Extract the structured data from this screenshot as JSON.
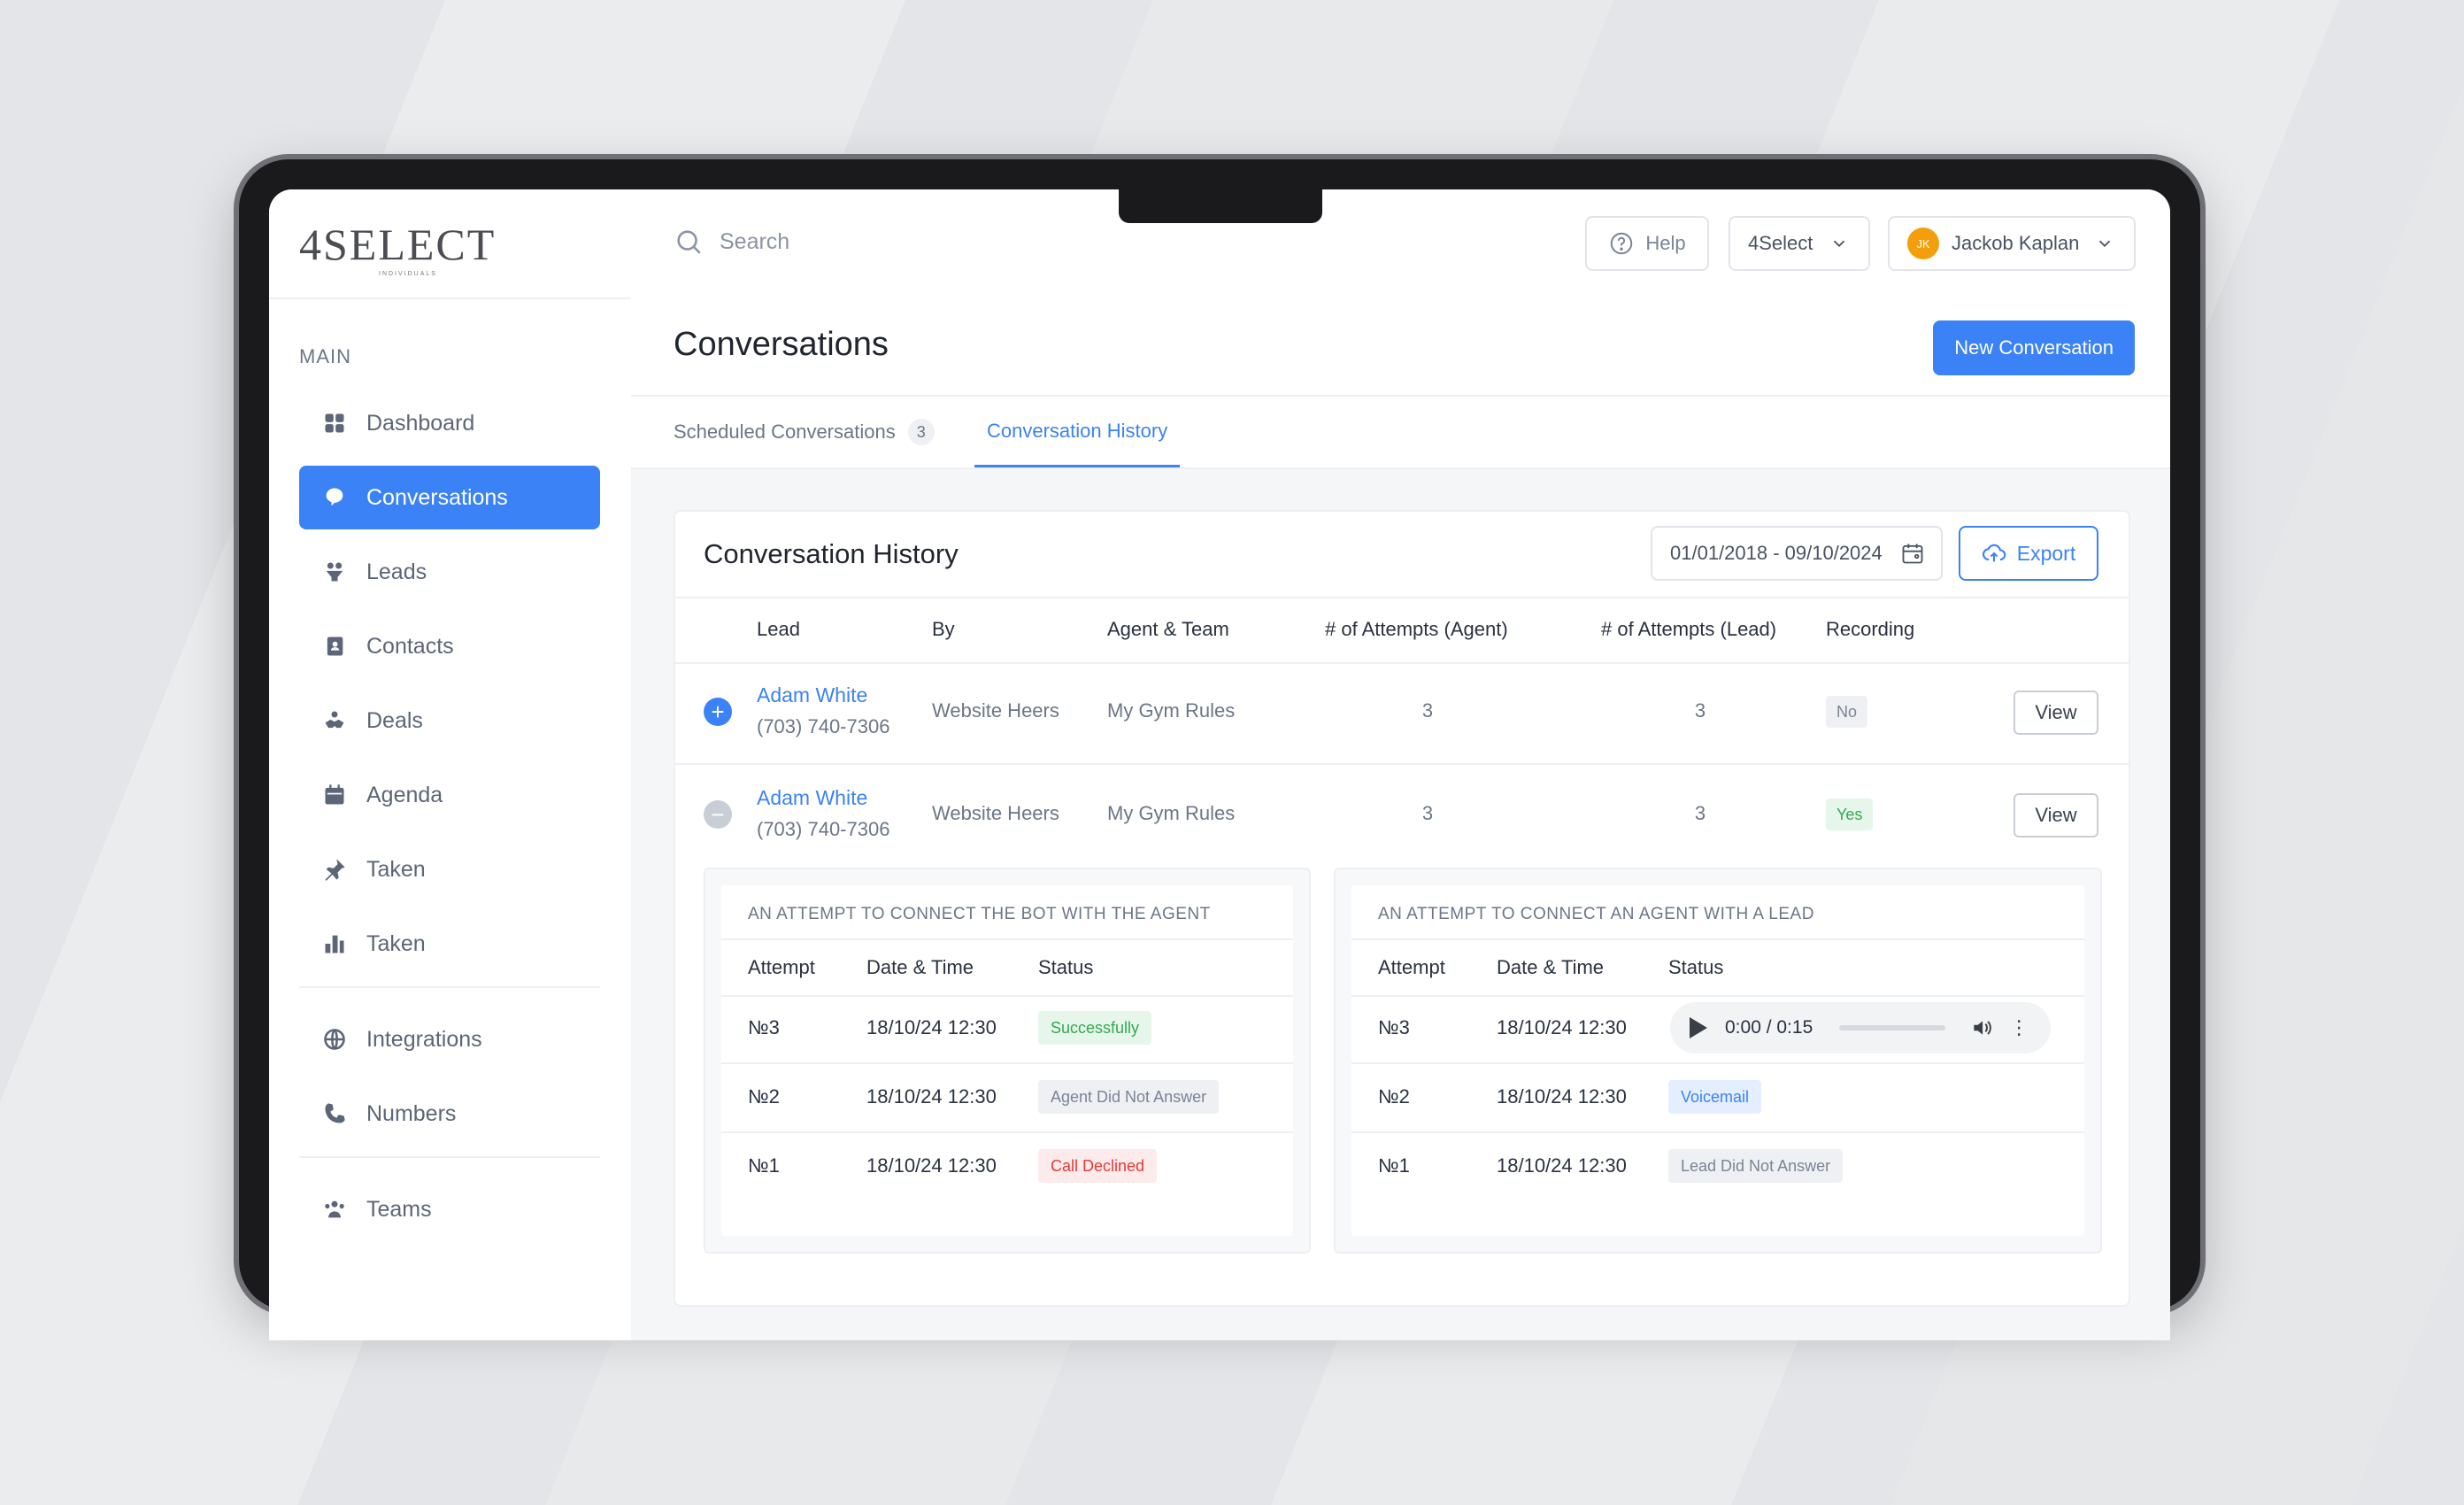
{
  "brand": {
    "logo_text": "4SELECT",
    "logo_sub": "INDIVIDUALS"
  },
  "search": {
    "placeholder": "Search"
  },
  "header": {
    "help": "Help",
    "workspace": "4Select",
    "user_name": "Jackob Kaplan",
    "user_initials": "JK"
  },
  "sidebar": {
    "section": "MAIN",
    "items": [
      {
        "label": "Dashboard",
        "icon": "grid-icon",
        "active": false
      },
      {
        "label": "Conversations",
        "icon": "chat-icon",
        "active": true
      },
      {
        "label": "Leads",
        "icon": "funnel-icon",
        "active": false
      },
      {
        "label": "Contacts",
        "icon": "contacts-book-icon",
        "active": false
      },
      {
        "label": "Deals",
        "icon": "handshake-icon",
        "active": false
      },
      {
        "label": "Agenda",
        "icon": "calendar-icon",
        "active": false
      },
      {
        "label": "Taken",
        "icon": "pin-icon",
        "active": false
      },
      {
        "label": "Taken",
        "icon": "bar-chart-icon",
        "active": false
      },
      {
        "label": "Integrations",
        "icon": "globe-icon",
        "active": false
      },
      {
        "label": "Numbers",
        "icon": "phone-icon",
        "active": false
      },
      {
        "label": "Teams",
        "icon": "team-icon",
        "active": false
      }
    ]
  },
  "page": {
    "title": "Conversations",
    "new_button": "New Conversation"
  },
  "tabs": {
    "scheduled": "Scheduled Conversations",
    "scheduled_count": "3",
    "history": "Conversation History"
  },
  "history": {
    "title": "Conversation History",
    "date_range": "01/01/2018 - 09/10/2024",
    "export": "Export",
    "columns": [
      "Lead",
      "By",
      "Agent & Team",
      "# of Attempts (Agent)",
      "# of Attempts (Lead)",
      "Recording"
    ],
    "rows": [
      {
        "name": "Adam White",
        "phone": "(703) 740-7306",
        "by": "Website Heers",
        "team": "My Gym Rules",
        "att_agent": "3",
        "att_lead": "3",
        "recording": "No",
        "view": "View"
      },
      {
        "name": "Adam White",
        "phone": "(703) 740-7306",
        "by": "Website Heers",
        "team": "My Gym Rules",
        "att_agent": "3",
        "att_lead": "3",
        "recording": "Yes",
        "view": "View"
      }
    ]
  },
  "bot_agent": {
    "title": "AN ATTEMPT TO CONNECT THE BOT WITH THE AGENT",
    "columns": [
      "Attempt",
      "Date & Time",
      "Status"
    ],
    "rows": [
      {
        "attempt": "№3",
        "datetime": "18/10/24 12:30",
        "status": "Successfully"
      },
      {
        "attempt": "№2",
        "datetime": "18/10/24 12:30",
        "status": "Agent Did Not Answer"
      },
      {
        "attempt": "№1",
        "datetime": "18/10/24 12:30",
        "status": "Call Declined"
      }
    ]
  },
  "agent_lead": {
    "title": "AN ATTEMPT TO CONNECT AN AGENT WITH A LEAD",
    "columns": [
      "Attempt",
      "Date & Time",
      "Status"
    ],
    "rows": [
      {
        "attempt": "№3",
        "datetime": "18/10/24 12:30",
        "player_time": "0:00 / 0:15"
      },
      {
        "attempt": "№2",
        "datetime": "18/10/24 12:30",
        "status": "Voicemail"
      },
      {
        "attempt": "№1",
        "datetime": "18/10/24 12:30",
        "status": "Lead Did Not Answer"
      }
    ]
  },
  "colors": {
    "accent": "#3b82f6",
    "success": "#34a853",
    "danger": "#e53935"
  }
}
